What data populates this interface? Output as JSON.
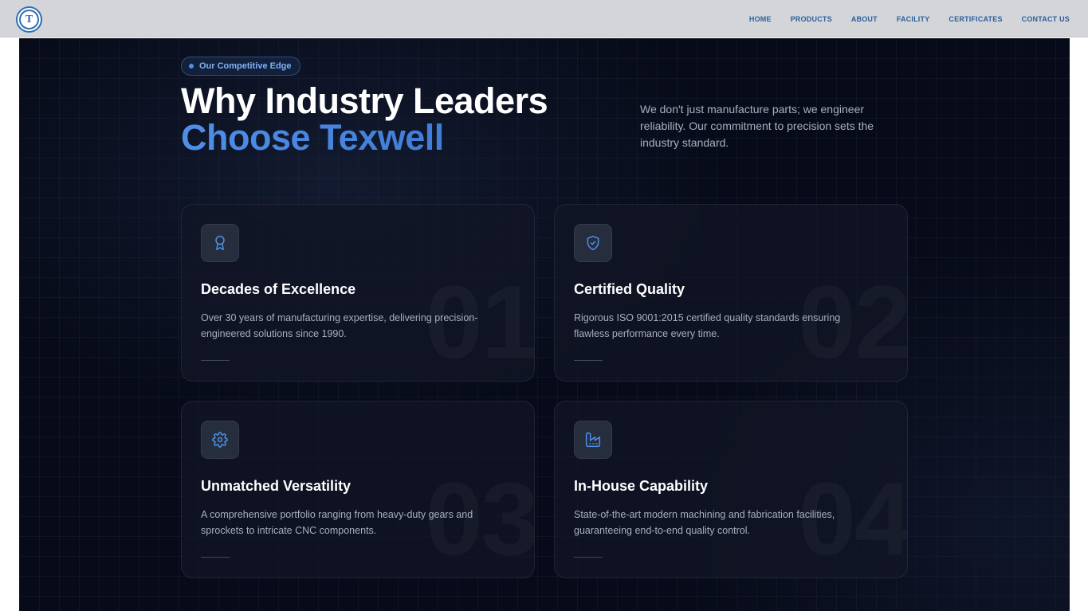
{
  "nav": {
    "logo_letter": "T",
    "links": [
      "HOME",
      "PRODUCTS",
      "ABOUT",
      "FACILITY",
      "CERTIFICATES",
      "CONTACT US"
    ]
  },
  "hero": {
    "badge": "Our Competitive Edge",
    "title_line1": "Why Industry Leaders",
    "title_line2": "Choose Texwell",
    "lead": "We don't just manufacture parts; we engineer reliability. Our commitment to precision sets the industry standard."
  },
  "cards": [
    {
      "number": "01",
      "icon": "award-icon",
      "title": "Decades of Excellence",
      "desc": "Over 30 years of manufacturing expertise, delivering precision-engineered solutions since 1990."
    },
    {
      "number": "02",
      "icon": "shield-check-icon",
      "title": "Certified Quality",
      "desc": "Rigorous ISO 9001:2015 certified quality standards ensuring flawless performance every time."
    },
    {
      "number": "03",
      "icon": "gear-icon",
      "title": "Unmatched Versatility",
      "desc": "A comprehensive portfolio ranging from heavy-duty gears and sprockets to intricate CNC components."
    },
    {
      "number": "04",
      "icon": "factory-icon",
      "title": "In-House Capability",
      "desc": "State-of-the-art modern machining and fabrication facilities, guaranteeing end-to-end quality control."
    }
  ],
  "colors": {
    "accent": "#4f8fe8",
    "background": "#070b19",
    "nav_text": "#2c5f9e"
  }
}
